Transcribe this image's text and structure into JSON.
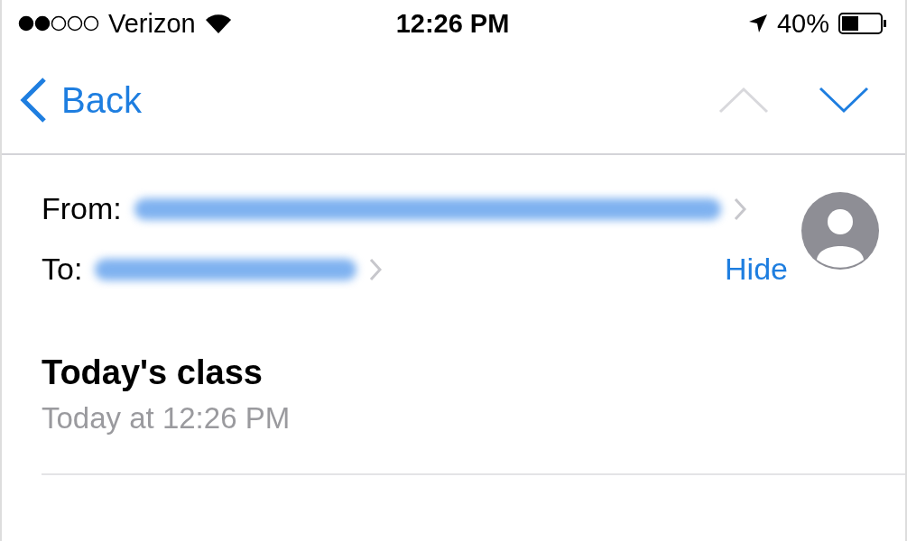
{
  "status_bar": {
    "carrier": "Verizon",
    "time": "12:26 PM",
    "battery": "40%"
  },
  "nav_bar": {
    "back": "Back",
    "previous": {
      "disabled": true
    },
    "next": {
      "disabled": false
    }
  },
  "header": {
    "from_label": "From:",
    "to_label": "To:",
    "hide": "Hide"
  },
  "message": {
    "subject": "Today's class",
    "date": "Today at 12:26 PM"
  }
}
